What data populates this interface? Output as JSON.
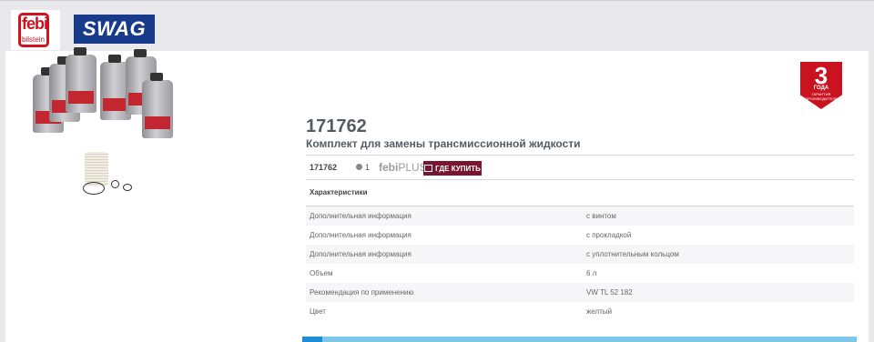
{
  "header": {
    "febi_logo_text": "febi",
    "febi_logo_sub": "bilstein",
    "swag_logo_text": "SWAG"
  },
  "guarantee": {
    "number": "3",
    "line1": "ГОДА",
    "line2": "ГАРАНТИЯ ПРОИЗВОДИТЕЛЯ"
  },
  "product": {
    "number": "171762",
    "title": "Комплект для замены трансмиссионной жидкости",
    "meta_number": "171762",
    "quantity": "1",
    "febiplus_bold": "febi",
    "febiplus_light": "PLUS",
    "buy_label": "ГДЕ КУПИТЬ"
  },
  "characteristics": {
    "title": "Характеристики",
    "rows": [
      {
        "name": "Дополнительная информация",
        "value": "с винтом"
      },
      {
        "name": "Дополнительная информация",
        "value": "с прокладкой"
      },
      {
        "name": "Дополнительная информация",
        "value": "с уплотнительным кольцом"
      },
      {
        "name": "Объем",
        "value": "6 л"
      },
      {
        "name": "Рекомендация по применению",
        "value": "VW TL 52 182"
      },
      {
        "name": "Цвет",
        "value": "желтый"
      }
    ]
  },
  "colors": {
    "febi_red": "#d0131f",
    "swag_blue": "#173a8b",
    "buy_button": "#7a1531",
    "accent_blue": "#1b8fd3"
  }
}
